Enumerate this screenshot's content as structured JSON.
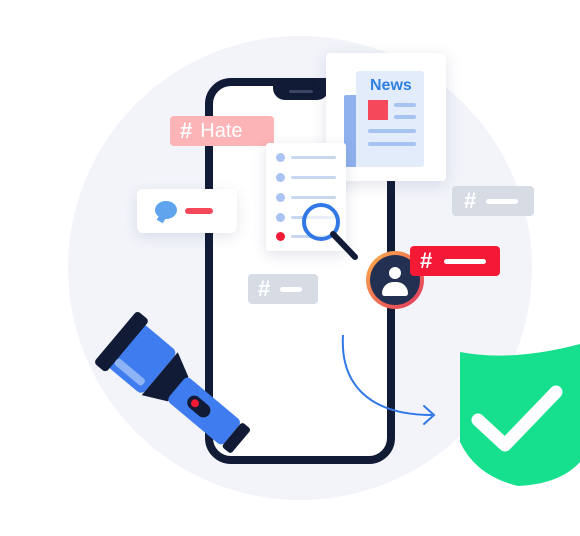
{
  "tags": {
    "hate": {
      "hash": "#",
      "label": "Hate"
    },
    "grey_right": {
      "hash": "#"
    },
    "grey_left": {
      "hash": "#"
    },
    "red": {
      "hash": "#"
    }
  },
  "news_card": {
    "title": "News"
  },
  "colors": {
    "background_circle": "#f2f4fa",
    "phone_frame": "#121b36",
    "accent_blue": "#2e7fe0",
    "hate_tag": "#fcb4b6",
    "alert_red": "#f41a36",
    "neutral_tag": "#d7dce4",
    "shield_green": "#16e08e",
    "flashlight_blue": "#3e7cf0"
  },
  "icons": [
    "comment-bubble-icon",
    "magnifier-icon",
    "news-icon",
    "user-avatar-icon",
    "flashlight-icon",
    "shield-check-icon",
    "curved-arrow-icon"
  ]
}
